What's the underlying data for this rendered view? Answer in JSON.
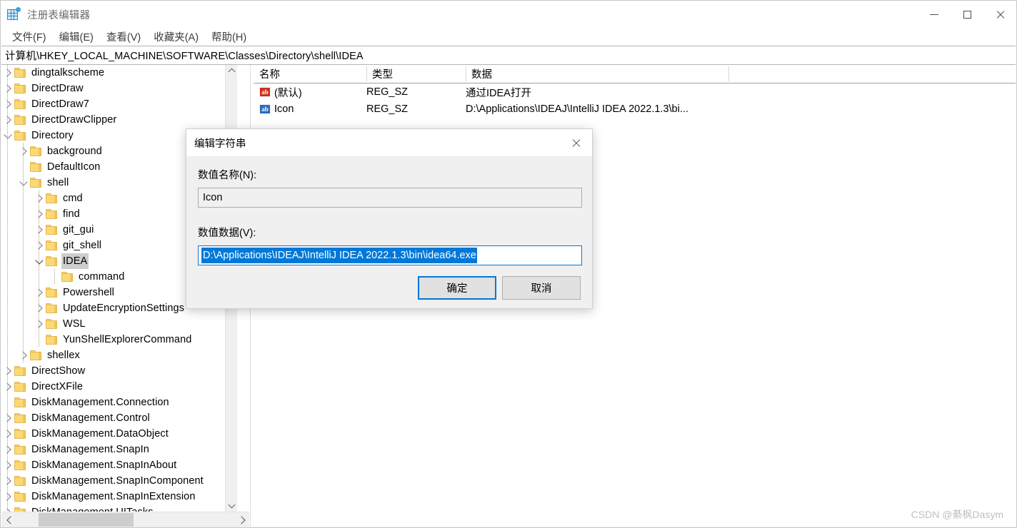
{
  "window": {
    "title": "注册表编辑器",
    "app_icon": "registry-grid-icon",
    "minimize_label": "—",
    "maximize_label": "□",
    "close_label": "✕"
  },
  "menu": {
    "items": [
      {
        "label": "文件(F)"
      },
      {
        "label": "编辑(E)"
      },
      {
        "label": "查看(V)"
      },
      {
        "label": "收藏夹(A)"
      },
      {
        "label": "帮助(H)"
      }
    ]
  },
  "address_bar": {
    "path": "计算机\\HKEY_LOCAL_MACHINE\\SOFTWARE\\Classes\\Directory\\shell\\IDEA"
  },
  "tree": {
    "rows": [
      {
        "label": "dingtalkscheme",
        "indent": 0,
        "twisty": "right",
        "selected": false
      },
      {
        "label": "DirectDraw",
        "indent": 0,
        "twisty": "right",
        "selected": false
      },
      {
        "label": "DirectDraw7",
        "indent": 0,
        "twisty": "right",
        "selected": false
      },
      {
        "label": "DirectDrawClipper",
        "indent": 0,
        "twisty": "right",
        "selected": false
      },
      {
        "label": "Directory",
        "indent": 0,
        "twisty": "down",
        "selected": false
      },
      {
        "label": "background",
        "indent": 1,
        "twisty": "right",
        "selected": false
      },
      {
        "label": "DefaultIcon",
        "indent": 1,
        "twisty": "none",
        "selected": false
      },
      {
        "label": "shell",
        "indent": 1,
        "twisty": "down",
        "selected": false
      },
      {
        "label": "cmd",
        "indent": 2,
        "twisty": "right",
        "selected": false
      },
      {
        "label": "find",
        "indent": 2,
        "twisty": "right",
        "selected": false
      },
      {
        "label": "git_gui",
        "indent": 2,
        "twisty": "right",
        "selected": false
      },
      {
        "label": "git_shell",
        "indent": 2,
        "twisty": "right",
        "selected": false
      },
      {
        "label": "IDEA",
        "indent": 2,
        "twisty": "down",
        "selected": true
      },
      {
        "label": "command",
        "indent": 3,
        "twisty": "none",
        "selected": false
      },
      {
        "label": "Powershell",
        "indent": 2,
        "twisty": "right",
        "selected": false
      },
      {
        "label": "UpdateEncryptionSettings",
        "indent": 2,
        "twisty": "right",
        "selected": false
      },
      {
        "label": "WSL",
        "indent": 2,
        "twisty": "right",
        "selected": false
      },
      {
        "label": "YunShellExplorerCommand",
        "indent": 2,
        "twisty": "none",
        "selected": false
      },
      {
        "label": "shellex",
        "indent": 1,
        "twisty": "right",
        "selected": false
      },
      {
        "label": "DirectShow",
        "indent": 0,
        "twisty": "right",
        "selected": false
      },
      {
        "label": "DirectXFile",
        "indent": 0,
        "twisty": "right",
        "selected": false
      },
      {
        "label": "DiskManagement.Connection",
        "indent": 0,
        "twisty": "none",
        "selected": false
      },
      {
        "label": "DiskManagement.Control",
        "indent": 0,
        "twisty": "right",
        "selected": false
      },
      {
        "label": "DiskManagement.DataObject",
        "indent": 0,
        "twisty": "right",
        "selected": false
      },
      {
        "label": "DiskManagement.SnapIn",
        "indent": 0,
        "twisty": "right",
        "selected": false
      },
      {
        "label": "DiskManagement.SnapInAbout",
        "indent": 0,
        "twisty": "right",
        "selected": false
      },
      {
        "label": "DiskManagement.SnapInComponent",
        "indent": 0,
        "twisty": "right",
        "selected": false
      },
      {
        "label": "DiskManagement.SnapInExtension",
        "indent": 0,
        "twisty": "right",
        "selected": false
      },
      {
        "label": "DiskManagement.UITasks",
        "indent": 0,
        "twisty": "right",
        "selected": false
      }
    ]
  },
  "value_list": {
    "columns": [
      {
        "label": "名称"
      },
      {
        "label": "类型"
      },
      {
        "label": "数据"
      }
    ],
    "rows": [
      {
        "icon": "string-value-icon",
        "icon_color": "#c8321e",
        "name": "(默认)",
        "type": "REG_SZ",
        "data": "通过IDEA打开"
      },
      {
        "icon": "string-value-icon",
        "icon_color": "#2a6bc4",
        "name": "Icon",
        "type": "REG_SZ",
        "data": "D:\\Applications\\IDEAJ\\IntelliJ IDEA 2022.1.3\\bi..."
      }
    ]
  },
  "dialog": {
    "title": "编辑字符串",
    "close_label": "✕",
    "name_label": "数值名称(N):",
    "name_value": "Icon",
    "data_label": "数值数据(V):",
    "data_value": "D:\\Applications\\IDEAJ\\IntelliJ IDEA 2022.1.3\\bin\\idea64.exe",
    "ok_label": "确定",
    "cancel_label": "取消",
    "accent_color": "#0078d7",
    "selection_color": "#0078d7"
  },
  "watermark": {
    "text": "CSDN @綦枫Dasym"
  }
}
